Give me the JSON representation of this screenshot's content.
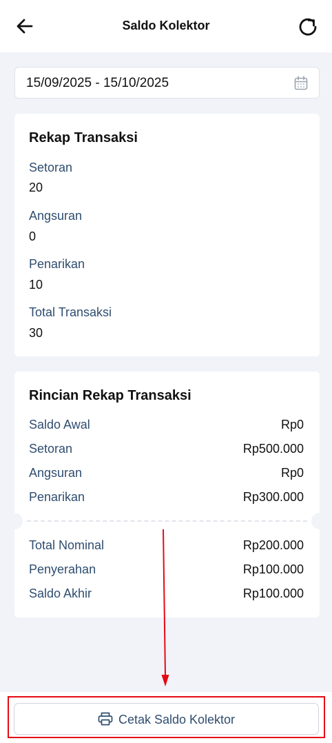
{
  "header": {
    "title": "Saldo Kolektor",
    "back_icon": "arrow-left-icon",
    "refresh_icon": "refresh-icon"
  },
  "date_range": {
    "value": "15/09/2025 - 15/10/2025",
    "icon": "calendar-icon"
  },
  "rekap": {
    "title": "Rekap Transaksi",
    "items": [
      {
        "label": "Setoran",
        "value": "20"
      },
      {
        "label": "Angsuran",
        "value": "0"
      },
      {
        "label": "Penarikan",
        "value": "10"
      },
      {
        "label": "Total Transaksi",
        "value": "30"
      }
    ]
  },
  "rincian": {
    "title": "Rincian Rekap Transaksi",
    "rows_top": [
      {
        "label": "Saldo Awal",
        "value": "Rp0"
      },
      {
        "label": "Setoran",
        "value": "Rp500.000"
      },
      {
        "label": "Angsuran",
        "value": "Rp0"
      },
      {
        "label": "Penarikan",
        "value": "Rp300.000"
      }
    ],
    "rows_bottom": [
      {
        "label": "Total Nominal",
        "value": "Rp200.000"
      },
      {
        "label": "Penyerahan",
        "value": "Rp100.000"
      },
      {
        "label": "Saldo Akhir",
        "value": "Rp100.000"
      }
    ]
  },
  "footer": {
    "print_label": "Cetak Saldo Kolektor",
    "print_icon": "printer-icon"
  },
  "colors": {
    "label": "#2f4d6f",
    "background": "#f1f3f8",
    "annotation": "#e50914"
  }
}
